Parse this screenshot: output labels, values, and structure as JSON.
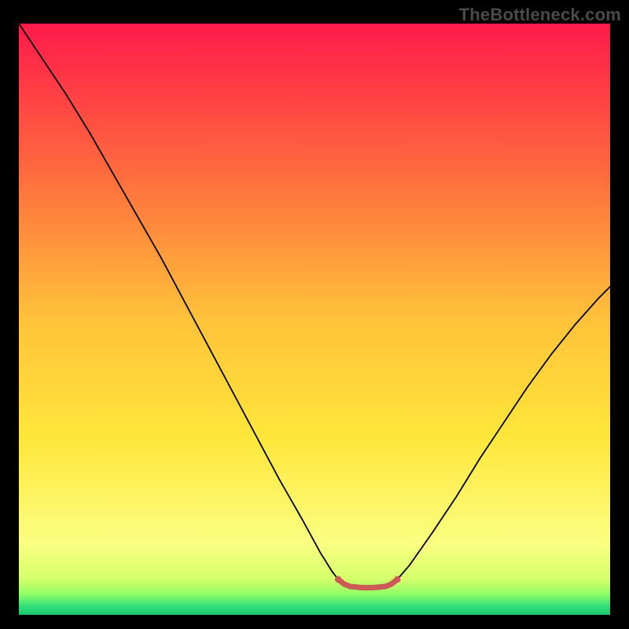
{
  "watermark": {
    "text": "TheBottleneck.com"
  },
  "chart_data": {
    "type": "line",
    "title": "",
    "xlabel": "",
    "ylabel": "",
    "xlim": [
      0,
      100
    ],
    "ylim": [
      0,
      100
    ],
    "grid": false,
    "legend": false,
    "background": {
      "type": "vertical-gradient",
      "stops": [
        {
          "pos": 0.0,
          "color": "#ff1a4b"
        },
        {
          "pos": 0.25,
          "color": "#ff6a3e"
        },
        {
          "pos": 0.5,
          "color": "#ffc23a"
        },
        {
          "pos": 0.7,
          "color": "#ffe63a"
        },
        {
          "pos": 0.88,
          "color": "#fbff82"
        },
        {
          "pos": 0.94,
          "color": "#d4ff6a"
        },
        {
          "pos": 0.965,
          "color": "#8fff66"
        },
        {
          "pos": 0.985,
          "color": "#33e07a"
        },
        {
          "pos": 1.0,
          "color": "#18c76a"
        }
      ]
    },
    "series": [
      {
        "name": "bottleneck-curve",
        "color": "#000000",
        "width": 1.8,
        "points": [
          {
            "x": 0.0,
            "y": 100.0
          },
          {
            "x": 4.0,
            "y": 94.0
          },
          {
            "x": 8.0,
            "y": 88.0
          },
          {
            "x": 12.0,
            "y": 81.5
          },
          {
            "x": 16.0,
            "y": 74.5
          },
          {
            "x": 20.0,
            "y": 67.5
          },
          {
            "x": 24.0,
            "y": 60.5
          },
          {
            "x": 28.0,
            "y": 53.0
          },
          {
            "x": 32.0,
            "y": 45.5
          },
          {
            "x": 36.0,
            "y": 38.0
          },
          {
            "x": 40.0,
            "y": 30.5
          },
          {
            "x": 44.0,
            "y": 23.0
          },
          {
            "x": 48.0,
            "y": 16.0
          },
          {
            "x": 51.0,
            "y": 10.5
          },
          {
            "x": 53.0,
            "y": 7.3
          },
          {
            "x": 54.0,
            "y": 6.0
          },
          {
            "x": 55.0,
            "y": 5.2
          },
          {
            "x": 56.0,
            "y": 4.8
          },
          {
            "x": 58.0,
            "y": 4.6
          },
          {
            "x": 60.0,
            "y": 4.6
          },
          {
            "x": 62.0,
            "y": 4.8
          },
          {
            "x": 63.0,
            "y": 5.2
          },
          {
            "x": 64.0,
            "y": 6.0
          },
          {
            "x": 66.0,
            "y": 8.3
          },
          {
            "x": 70.0,
            "y": 14.0
          },
          {
            "x": 74.0,
            "y": 20.0
          },
          {
            "x": 78.0,
            "y": 26.5
          },
          {
            "x": 82.0,
            "y": 32.5
          },
          {
            "x": 86.0,
            "y": 38.5
          },
          {
            "x": 90.0,
            "y": 44.0
          },
          {
            "x": 94.0,
            "y": 49.0
          },
          {
            "x": 98.0,
            "y": 53.5
          },
          {
            "x": 100.0,
            "y": 55.5
          }
        ]
      },
      {
        "name": "optimal-band",
        "color": "#cc5a57",
        "width": 7.0,
        "points": [
          {
            "x": 54.0,
            "y": 6.0
          },
          {
            "x": 55.0,
            "y": 5.2
          },
          {
            "x": 56.0,
            "y": 4.8
          },
          {
            "x": 58.0,
            "y": 4.6
          },
          {
            "x": 60.0,
            "y": 4.6
          },
          {
            "x": 62.0,
            "y": 4.8
          },
          {
            "x": 63.0,
            "y": 5.2
          },
          {
            "x": 64.0,
            "y": 6.0
          }
        ]
      }
    ],
    "markers": [
      {
        "series": "optimal-band",
        "x": 54.0,
        "y": 6.0,
        "r": 4.2,
        "color": "#cc5a57"
      },
      {
        "series": "optimal-band",
        "x": 64.0,
        "y": 6.0,
        "r": 4.2,
        "color": "#cc5a57"
      }
    ]
  }
}
